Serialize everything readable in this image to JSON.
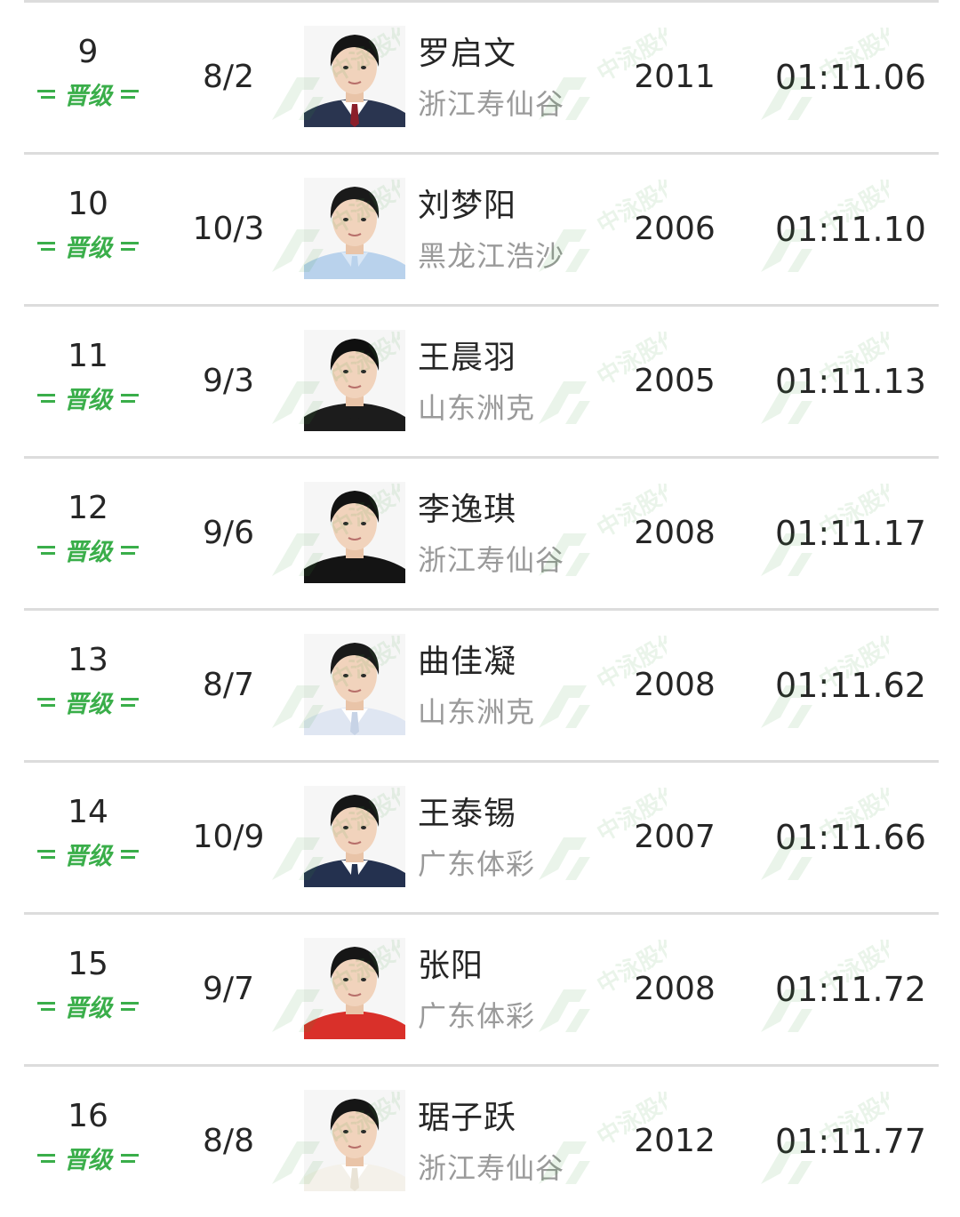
{
  "colors": {
    "qualify_green": "#3aae4a",
    "divider": "#dcdcdc",
    "team_gray": "#9a9a9a"
  },
  "watermark": {
    "icon": "zhongyong-logo-watermark-icon",
    "text": "中泳股份"
  },
  "rows": [
    {
      "rank": "9",
      "status": "晋级",
      "lane": "8/2",
      "name": "罗启文",
      "team": "浙江寿仙谷",
      "year": "2011",
      "time": "01:11.06",
      "photo": {
        "hair": "#151515",
        "shirt": "#2a3550",
        "collar": "#ffffff",
        "accent": "#8b1e2a"
      }
    },
    {
      "rank": "10",
      "status": "晋级",
      "lane": "10/3",
      "name": "刘梦阳",
      "team": "黑龙江浩沙",
      "year": "2006",
      "time": "01:11.10",
      "photo": {
        "hair": "#1a1a1a",
        "shirt": "#b9d2ec",
        "collar": "#d9e7f6",
        "accent": "#b9d2ec"
      }
    },
    {
      "rank": "11",
      "status": "晋级",
      "lane": "9/3",
      "name": "王晨羽",
      "team": "山东洲克",
      "year": "2005",
      "time": "01:11.13",
      "photo": {
        "hair": "#101010",
        "shirt": "#1c1c1c",
        "collar": "#1c1c1c",
        "accent": "#1c1c1c"
      }
    },
    {
      "rank": "12",
      "status": "晋级",
      "lane": "9/6",
      "name": "李逸琪",
      "team": "浙江寿仙谷",
      "year": "2008",
      "time": "01:11.17",
      "photo": {
        "hair": "#121212",
        "shirt": "#141414",
        "collar": "#141414",
        "accent": "#141414"
      }
    },
    {
      "rank": "13",
      "status": "晋级",
      "lane": "8/7",
      "name": "曲佳凝",
      "team": "山东洲克",
      "year": "2008",
      "time": "01:11.62",
      "photo": {
        "hair": "#1a1a1a",
        "shirt": "#dfe6f2",
        "collar": "#ffffff",
        "accent": "#c7d3e6"
      }
    },
    {
      "rank": "14",
      "status": "晋级",
      "lane": "10/9",
      "name": "王泰锡",
      "team": "广东体彩",
      "year": "2007",
      "time": "01:11.66",
      "photo": {
        "hair": "#161616",
        "shirt": "#24314f",
        "collar": "#ffffff",
        "accent": "#24314f"
      }
    },
    {
      "rank": "15",
      "status": "晋级",
      "lane": "9/7",
      "name": "张阳",
      "team": "广东体彩",
      "year": "2008",
      "time": "01:11.72",
      "photo": {
        "hair": "#161616",
        "shirt": "#d9302a",
        "collar": "#d9302a",
        "accent": "#d9302a"
      }
    },
    {
      "rank": "16",
      "status": "晋级",
      "lane": "8/8",
      "name": "琚子跃",
      "team": "浙江寿仙谷",
      "year": "2012",
      "time": "01:11.77",
      "photo": {
        "hair": "#161616",
        "shirt": "#f4f1ea",
        "collar": "#ffffff",
        "accent": "#e9e3d6"
      }
    }
  ]
}
